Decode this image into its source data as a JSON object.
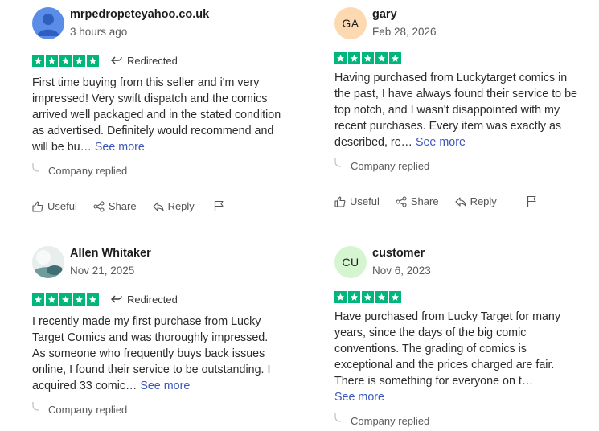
{
  "colors": {
    "star_green": "#00b67a",
    "link": "#3c57bc"
  },
  "reviews": [
    {
      "author": "mrpedropeteyahoo.co.uk",
      "date": "3 hours ago",
      "avatar": {
        "type": "default-person-icon",
        "bg": "#5b8de8"
      },
      "rating": 5,
      "redirected_label": "Redirected",
      "text": "First time buying from this seller and i'm very impressed! Very swift dispatch and the comics arrived well packaged and in the stated condition as advertised. Definitely would recommend and will be bu…",
      "see_more": "See more",
      "company_replied": "Company replied",
      "actions": {
        "useful": "Useful",
        "share": "Share",
        "reply": "Reply"
      }
    },
    {
      "author": "gary",
      "date": "Feb 28, 2026",
      "avatar": {
        "type": "initials",
        "initials": "GA",
        "bg": "#fcd9b0"
      },
      "rating": 5,
      "text": "Having purchased from Luckytarget comics in the past, I have always found their service to be top notch, and I wasn't disappointed with my recent purchases. Every item was exactly as described, re…",
      "see_more": "See more",
      "company_replied": "Company replied",
      "actions": {
        "useful": "Useful",
        "share": "Share",
        "reply": "Reply"
      }
    },
    {
      "author": "Allen Whitaker",
      "date": "Nov 21, 2025",
      "avatar": {
        "type": "photo-icon",
        "bg": "#dce6e4"
      },
      "rating": 5,
      "redirected_label": "Redirected",
      "text": "I recently made my first purchase from Lucky Target Comics and was thoroughly impressed. As someone who frequently buys back issues online, I found their service to be outstanding. I acquired 33 comic…",
      "see_more": "See more",
      "company_replied": "Company replied"
    },
    {
      "author": "customer",
      "date": "Nov 6, 2023",
      "avatar": {
        "type": "initials",
        "initials": "CU",
        "bg": "#d5f5d0"
      },
      "rating": 5,
      "text": "Have purchased from Lucky Target for many years, since the days of the big comic conventions. The grading of comics is exceptional and the prices charged are fair. There is something for everyone on t…",
      "see_more": "See more",
      "company_replied": "Company replied"
    }
  ]
}
